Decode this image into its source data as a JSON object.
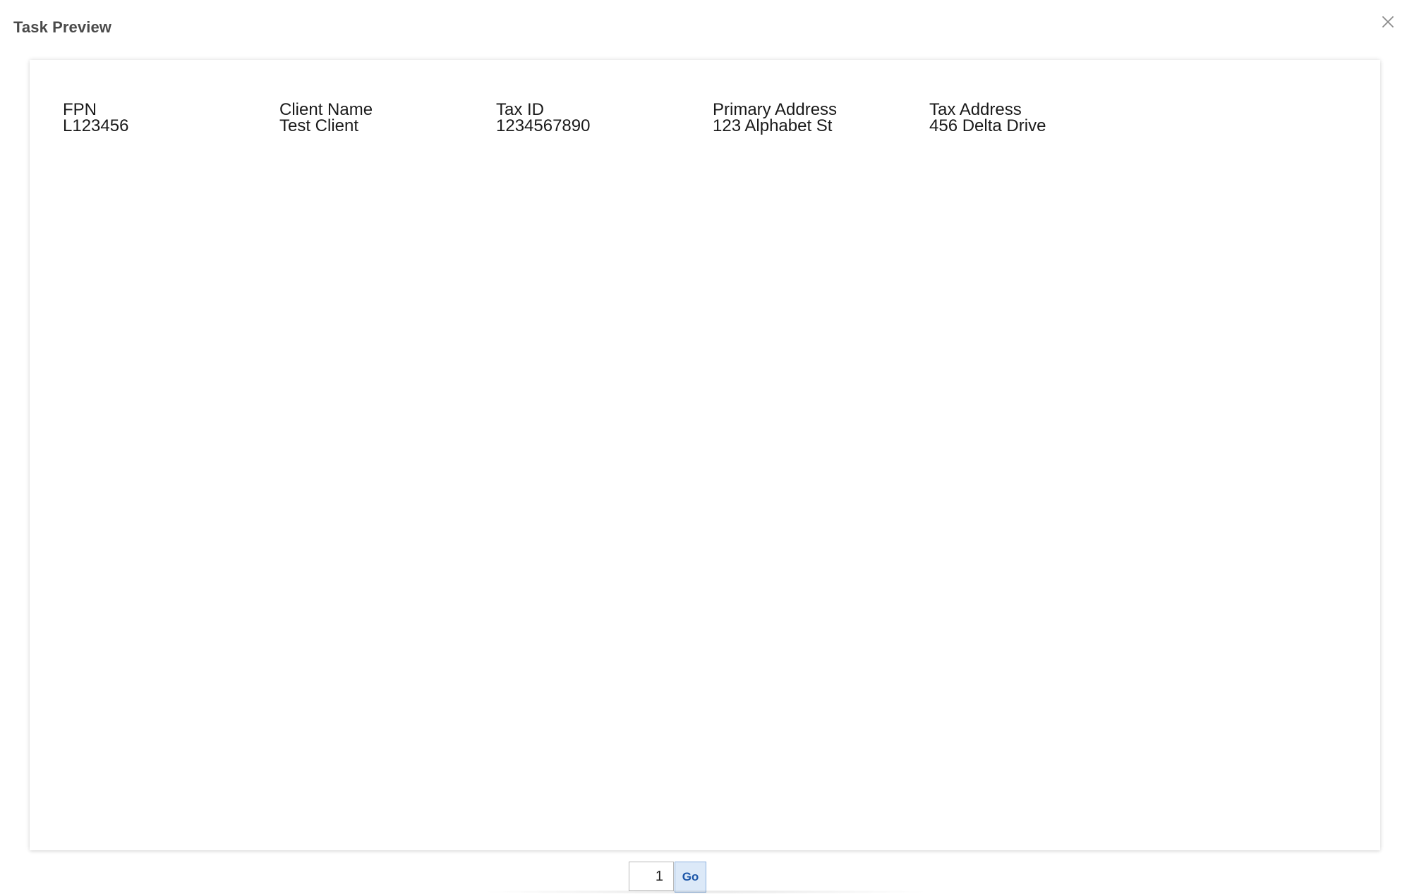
{
  "dialog": {
    "title": "Task Preview",
    "close_icon": "close-icon"
  },
  "preview": {
    "fields": [
      {
        "label": "FPN",
        "value": "L123456"
      },
      {
        "label": "Client Name",
        "value": "Test Client"
      },
      {
        "label": "Tax ID",
        "value": "1234567890"
      },
      {
        "label": "Primary Address",
        "value": "123 Alphabet St"
      },
      {
        "label": "Tax Address",
        "value": "456 Delta Drive"
      }
    ]
  },
  "pager": {
    "page_value": "1",
    "go_label": "Go"
  },
  "colors": {
    "go_background": "#dce9f8",
    "go_text": "#1c56a8",
    "title_text": "#4a4a4a"
  }
}
